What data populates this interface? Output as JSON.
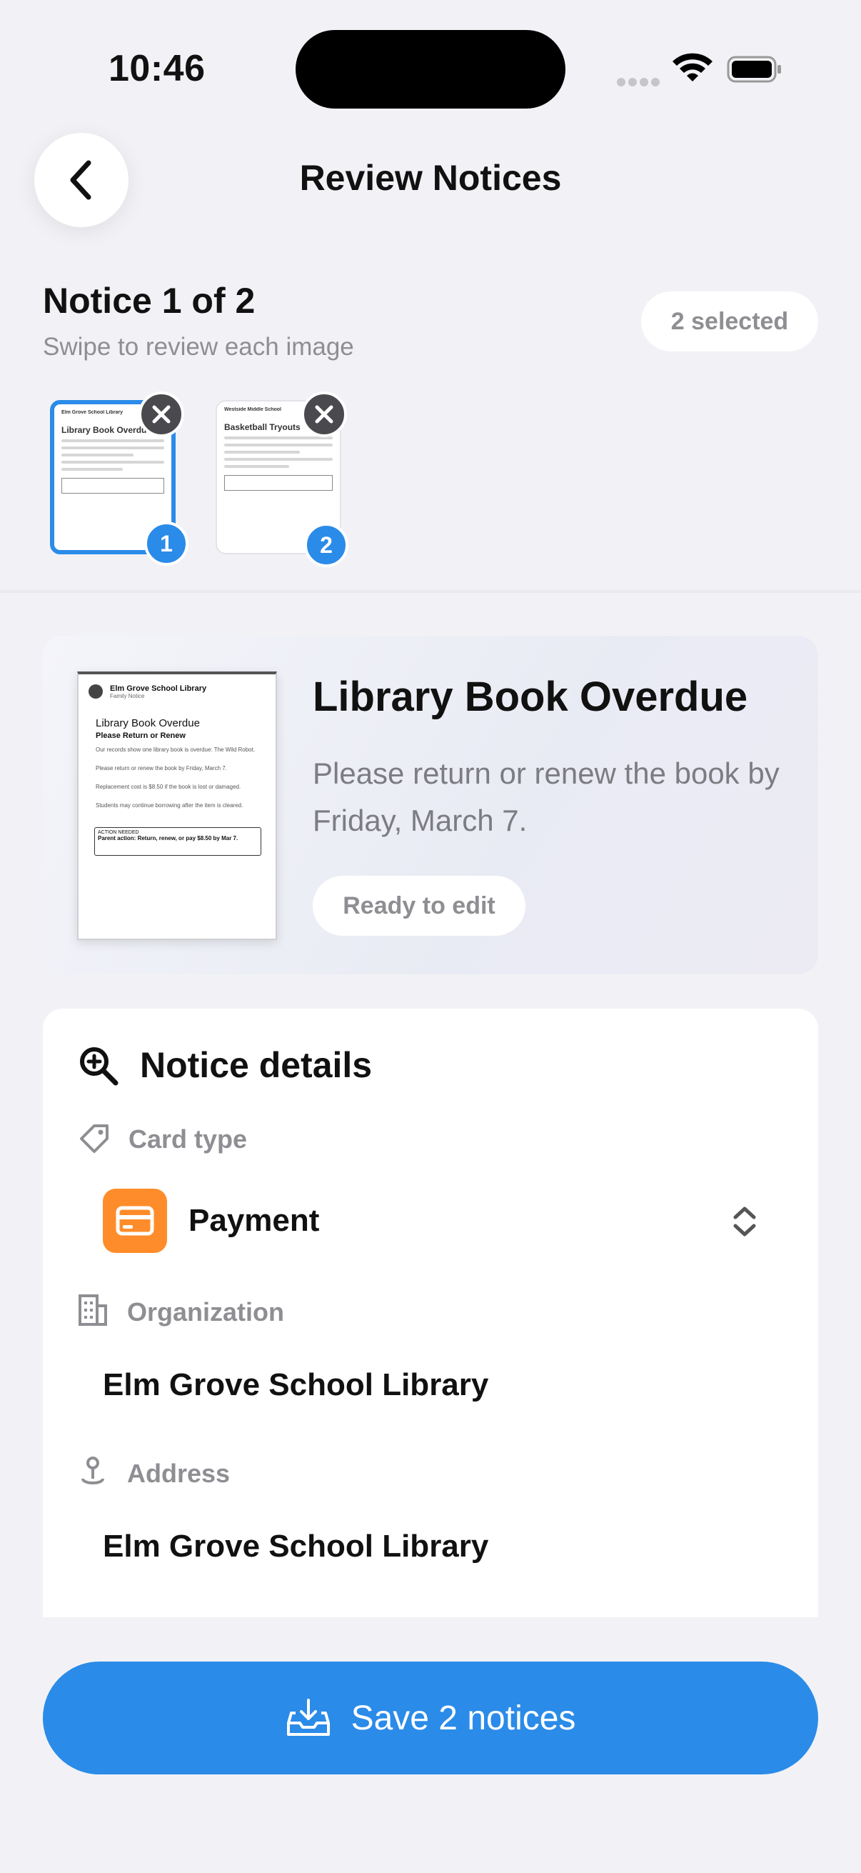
{
  "status_bar": {
    "time": "10:46"
  },
  "header": {
    "title": "Review Notices"
  },
  "counter": {
    "title": "Notice 1 of 2",
    "hint": "Swipe to review each image",
    "selected": "2 selected"
  },
  "thumbnails": [
    {
      "badge": "1",
      "title": "Library Book Overdue",
      "org": "Elm Grove School Library"
    },
    {
      "badge": "2",
      "title": "Basketball Tryouts",
      "org": "Westside Middle School"
    }
  ],
  "preview": {
    "title": "Library Book Overdue",
    "description": "Please return or renew the book by Friday, March 7.",
    "status": "Ready to edit",
    "doc": {
      "org": "Elm Grove School Library",
      "sub": "Family Notice",
      "title": "Library Book Overdue",
      "subtitle": "Please Return or Renew",
      "p1": "Our records show one library book is overdue: The Wild Robot.",
      "p2": "Please return or renew the book by Friday, March 7.",
      "p3": "Replacement cost is $8.50 if the book is lost or damaged.",
      "p4": "Students may continue borrowing after the item is cleared.",
      "action_label": "ACTION NEEDED",
      "action_text": "Parent action: Return, renew, or pay $8.50 by Mar 7."
    }
  },
  "details": {
    "title": "Notice details",
    "card_type_label": "Card type",
    "card_type_value": "Payment",
    "organization_label": "Organization",
    "organization_value": "Elm Grove School Library",
    "address_label": "Address",
    "address_value": "Elm Grove School Library"
  },
  "footer": {
    "save_label": "Save 2 notices"
  },
  "colors": {
    "accent": "#2b8be8",
    "payment": "#ff8c2a"
  }
}
